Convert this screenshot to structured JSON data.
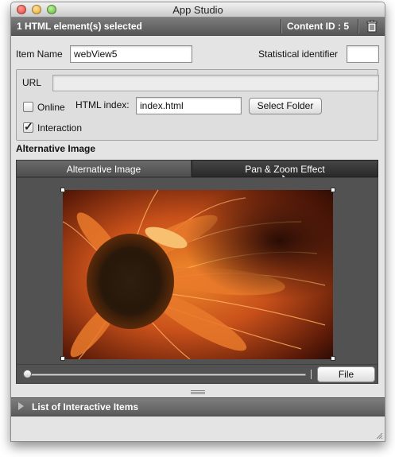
{
  "window": {
    "title": "App Studio"
  },
  "selection_bar": {
    "text": "1 HTML element(s) selected",
    "content_id_label": "Content ID : 5",
    "trash_icon": "trash-icon"
  },
  "form": {
    "item_name_label": "Item Name",
    "item_name_value": "webView5",
    "stat_id_label": "Statistical identifier",
    "stat_id_value": "",
    "url_label": "URL",
    "url_value": "",
    "online_label": "Online",
    "online_checked": false,
    "html_index_label": "HTML index:",
    "html_index_value": "index.html",
    "select_folder_label": "Select Folder",
    "interaction_label": "Interaction",
    "interaction_checked": true
  },
  "alternative_image": {
    "section_title": "Alternative Image",
    "tabs": [
      {
        "label": "Alternative Image",
        "active": false
      },
      {
        "label": "Pan & Zoom Effect",
        "active": true
      }
    ],
    "slider_value": 0,
    "file_button_label": "File"
  },
  "list_bar": {
    "label": "List of Interactive Items"
  },
  "colors": {
    "panel": "#e4e4e4",
    "dark_bar": "#5a5a5a",
    "stage": "#525252"
  }
}
